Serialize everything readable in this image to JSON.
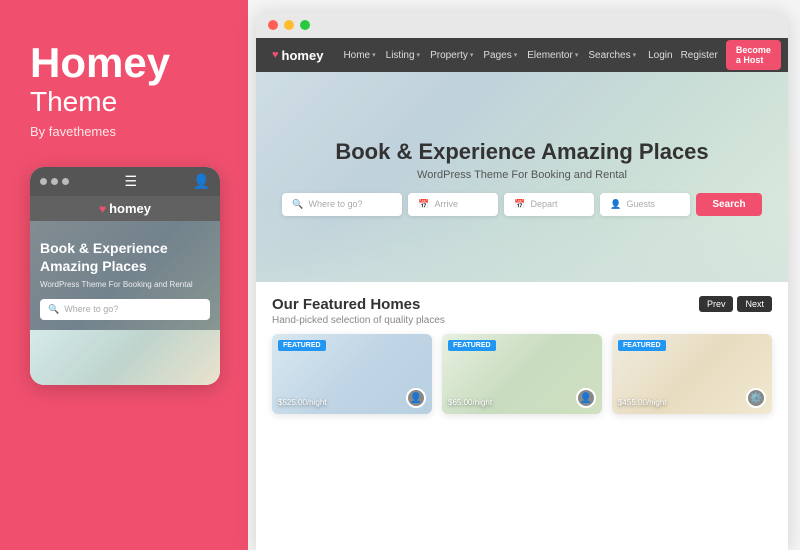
{
  "left": {
    "title": "Homey",
    "subtitle": "Theme",
    "by": "By favethemes"
  },
  "mobile": {
    "hero_title": "Book & Experience\nAmazing Places",
    "hero_subtitle": "WordPress Theme For Booking and Rental",
    "search_placeholder": "Where to go?",
    "logo": "homey"
  },
  "browser": {
    "dots": [
      "red",
      "yellow",
      "green"
    ]
  },
  "site": {
    "logo": "homey",
    "nav_links": [
      {
        "label": "Home",
        "has_caret": true
      },
      {
        "label": "Listing",
        "has_caret": true
      },
      {
        "label": "Property",
        "has_caret": true
      },
      {
        "label": "Pages",
        "has_caret": true
      },
      {
        "label": "Elementor",
        "has_caret": true
      },
      {
        "label": "Searches",
        "has_caret": true
      }
    ],
    "nav_actions": [
      {
        "label": "Login"
      },
      {
        "label": "Register"
      }
    ],
    "become_host": "Become a Host",
    "hero": {
      "title": "Book & Experience Amazing Places",
      "subtitle": "WordPress Theme For Booking and Rental",
      "search_fields": [
        {
          "placeholder": "Where to go?",
          "icon": "🔍"
        },
        {
          "placeholder": "Arrive",
          "icon": "📅"
        },
        {
          "placeholder": "Depart",
          "icon": "📅"
        },
        {
          "placeholder": "Guests",
          "icon": "👤"
        }
      ],
      "search_btn": "Search"
    },
    "featured": {
      "title": "Our Featured Homes",
      "subtitle": "Hand-picked selection of quality places",
      "prev": "Prev",
      "next": "Next",
      "cards": [
        {
          "badge": "FEATURED",
          "price": "$525.00",
          "period": "/night",
          "color": "card-img-1"
        },
        {
          "badge": "FEATURED",
          "price": "$65.00",
          "period": "/night",
          "color": "card-img-2"
        },
        {
          "badge": "FEATURED",
          "price": "$455.00",
          "period": "/night",
          "color": "card-img-3"
        }
      ]
    }
  }
}
